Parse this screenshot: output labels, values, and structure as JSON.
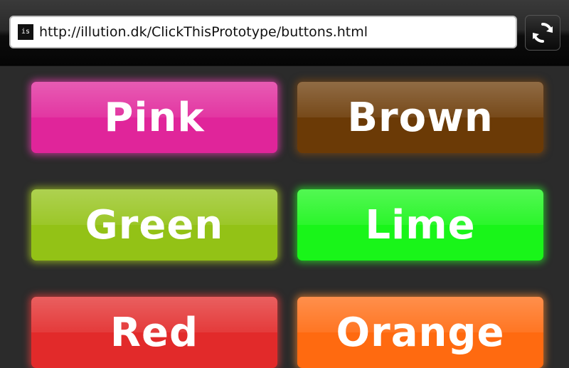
{
  "browser": {
    "url": "http://illution.dk/ClickThisPrototype/buttons.html",
    "favicon_text": "is",
    "refresh_icon": "refresh-icon"
  },
  "buttons": [
    {
      "label": "Pink",
      "color": "#e0259a",
      "glow": "#ff3fbf"
    },
    {
      "label": "Brown",
      "color": "#6b3a06",
      "glow": "#8a4e10"
    },
    {
      "label": "Green",
      "color": "#93c216",
      "glow": "#b5e020"
    },
    {
      "label": "Lime",
      "color": "#19f519",
      "glow": "#2aff2a"
    },
    {
      "label": "Red",
      "color": "#e22a2a",
      "glow": "#ff4040"
    },
    {
      "label": "Orange",
      "color": "#ff6a10",
      "glow": "#ff8a30"
    }
  ]
}
